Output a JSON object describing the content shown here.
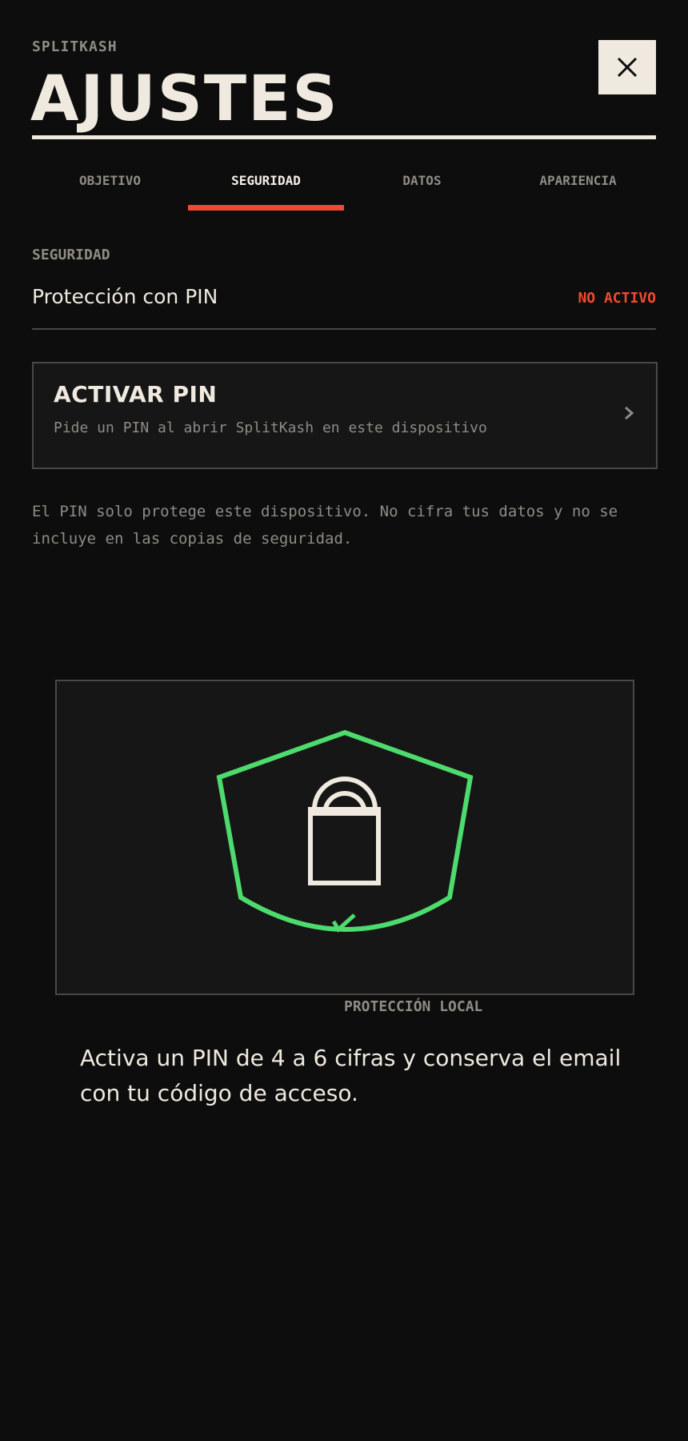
{
  "header": {
    "brand": "SPLITKASH",
    "title": "AJUSTES",
    "close_icon": "close-icon"
  },
  "tabs": [
    {
      "label": "OBJETIVO",
      "active": false
    },
    {
      "label": "SEGURIDAD",
      "active": true
    },
    {
      "label": "DATOS",
      "active": false
    },
    {
      "label": "APARIENCIA",
      "active": false
    }
  ],
  "security": {
    "section_label": "SEGURIDAD",
    "pin_label": "Protección con PIN",
    "pin_status": "NO ACTIVO",
    "activate": {
      "title": "ACTIVAR PIN",
      "description": "Pide un PIN al abrir SplitKash en este dispositivo",
      "icon": "chevron-right-icon"
    },
    "note": "El PIN solo protege este dispositivo. No cifra tus datos y no se incluye en las copias de seguridad."
  },
  "illustration": {
    "icon": "shield-lock-icon",
    "caption": "PROTECCIÓN LOCAL"
  },
  "footer_text": "Activa un PIN de 4 a 6 cifras y conserva el email con tu código de acceso.",
  "colors": {
    "background": "#0d0d0d",
    "card": "#161616",
    "text": "#efe9df",
    "muted": "#8f8b85",
    "accent": "#ef4a2f",
    "success": "#4ddb6e"
  }
}
